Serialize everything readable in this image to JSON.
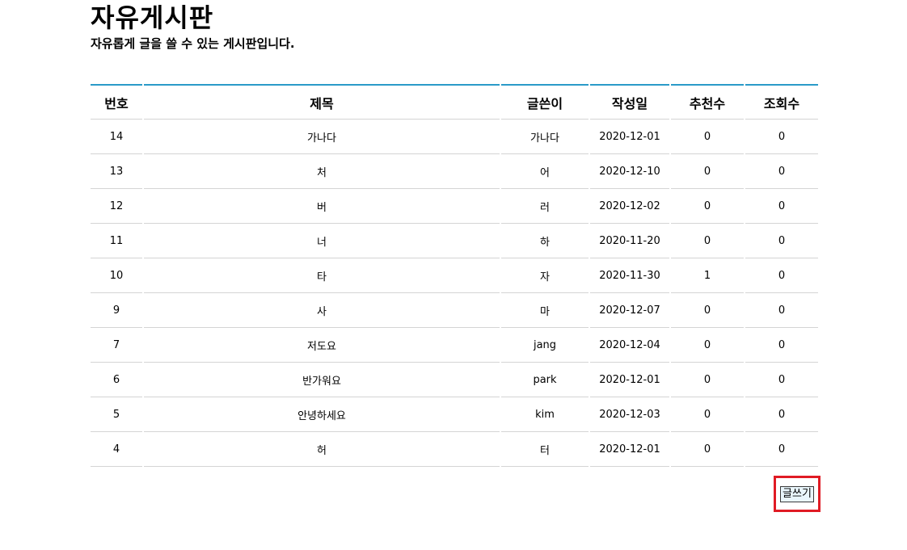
{
  "header": {
    "title": "자유게시판",
    "subtitle": "자유롭게 글을 쓸 수 있는 게시판입니다."
  },
  "table": {
    "columns": [
      "번호",
      "제목",
      "글쓴이",
      "작성일",
      "추천수",
      "조회수"
    ],
    "rows": [
      [
        "14",
        "가나다",
        "가나다",
        "2020-12-01",
        "0",
        "0"
      ],
      [
        "13",
        "처",
        "어",
        "2020-12-10",
        "0",
        "0"
      ],
      [
        "12",
        "버",
        "러",
        "2020-12-02",
        "0",
        "0"
      ],
      [
        "11",
        "너",
        "하",
        "2020-11-20",
        "0",
        "0"
      ],
      [
        "10",
        "타",
        "자",
        "2020-11-30",
        "1",
        "0"
      ],
      [
        "9",
        "사",
        "마",
        "2020-12-07",
        "0",
        "0"
      ],
      [
        "7",
        "저도요",
        "jang",
        "2020-12-04",
        "0",
        "0"
      ],
      [
        "6",
        "반가워요",
        "park",
        "2020-12-01",
        "0",
        "0"
      ],
      [
        "5",
        "안녕하세요",
        "kim",
        "2020-12-03",
        "0",
        "0"
      ],
      [
        "4",
        "허",
        "터",
        "2020-12-01",
        "0",
        "0"
      ]
    ]
  },
  "actions": {
    "write_label": "글쓰기"
  },
  "colors": {
    "header_border": "#2a9ac8",
    "highlight_box": "#e01b24",
    "button_bg": "#e9f6fc"
  }
}
